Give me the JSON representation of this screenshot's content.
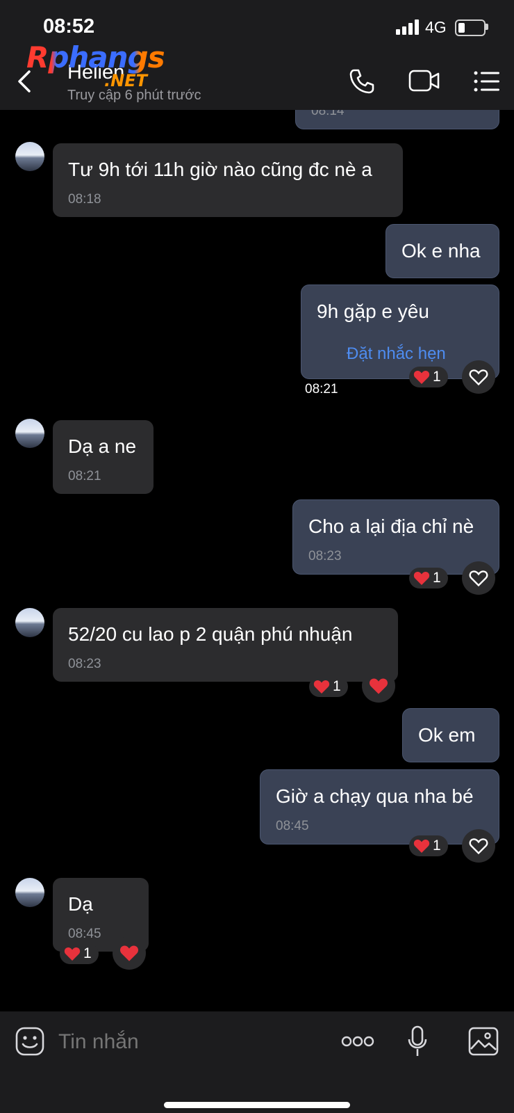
{
  "status": {
    "time": "08:52",
    "network": "4G"
  },
  "watermark": {
    "main": "Rphangs",
    "suffix": ".NET"
  },
  "header": {
    "name": "Helien",
    "last_seen": "Truy cập 6 phút trước"
  },
  "messages": [
    {
      "dir": "out",
      "time": "08:14"
    },
    {
      "dir": "in",
      "text": "Tư 9h tới 11h giờ nào cũng đc nè a",
      "time": "08:18"
    },
    {
      "dir": "out",
      "text": "Ok e nha"
    },
    {
      "dir": "out",
      "text": "9h gặp e yêu",
      "reminder": "Đặt nhắc hẹn",
      "time": "08:21",
      "reaction_count": "1"
    },
    {
      "dir": "in",
      "text": "Dạ a ne",
      "time": "08:21"
    },
    {
      "dir": "out",
      "text": "Cho a lại địa chỉ nè",
      "time": "08:23",
      "reaction_count": "1"
    },
    {
      "dir": "in",
      "text": "52/20 cu lao p 2 quận phú nhuận",
      "time": "08:23",
      "reaction_count": "1"
    },
    {
      "dir": "out",
      "text": "Ok em"
    },
    {
      "dir": "out",
      "text": "Giờ a chạy qua nha bé",
      "time": "08:45",
      "reaction_count": "1"
    },
    {
      "dir": "in",
      "text": "Dạ",
      "time": "08:45",
      "reaction_count": "1"
    }
  ],
  "composer": {
    "placeholder": "Tin nhắn"
  },
  "colors": {
    "accent": "#4e8cf0",
    "incoming": "#2c2c2e",
    "outgoing": "#3a4255",
    "heart": "#e8323c"
  },
  "icons": [
    "back-icon",
    "phone-icon",
    "video-icon",
    "menu-icon",
    "heart-icon",
    "sticker-icon",
    "more-icon",
    "mic-icon",
    "image-icon"
  ]
}
